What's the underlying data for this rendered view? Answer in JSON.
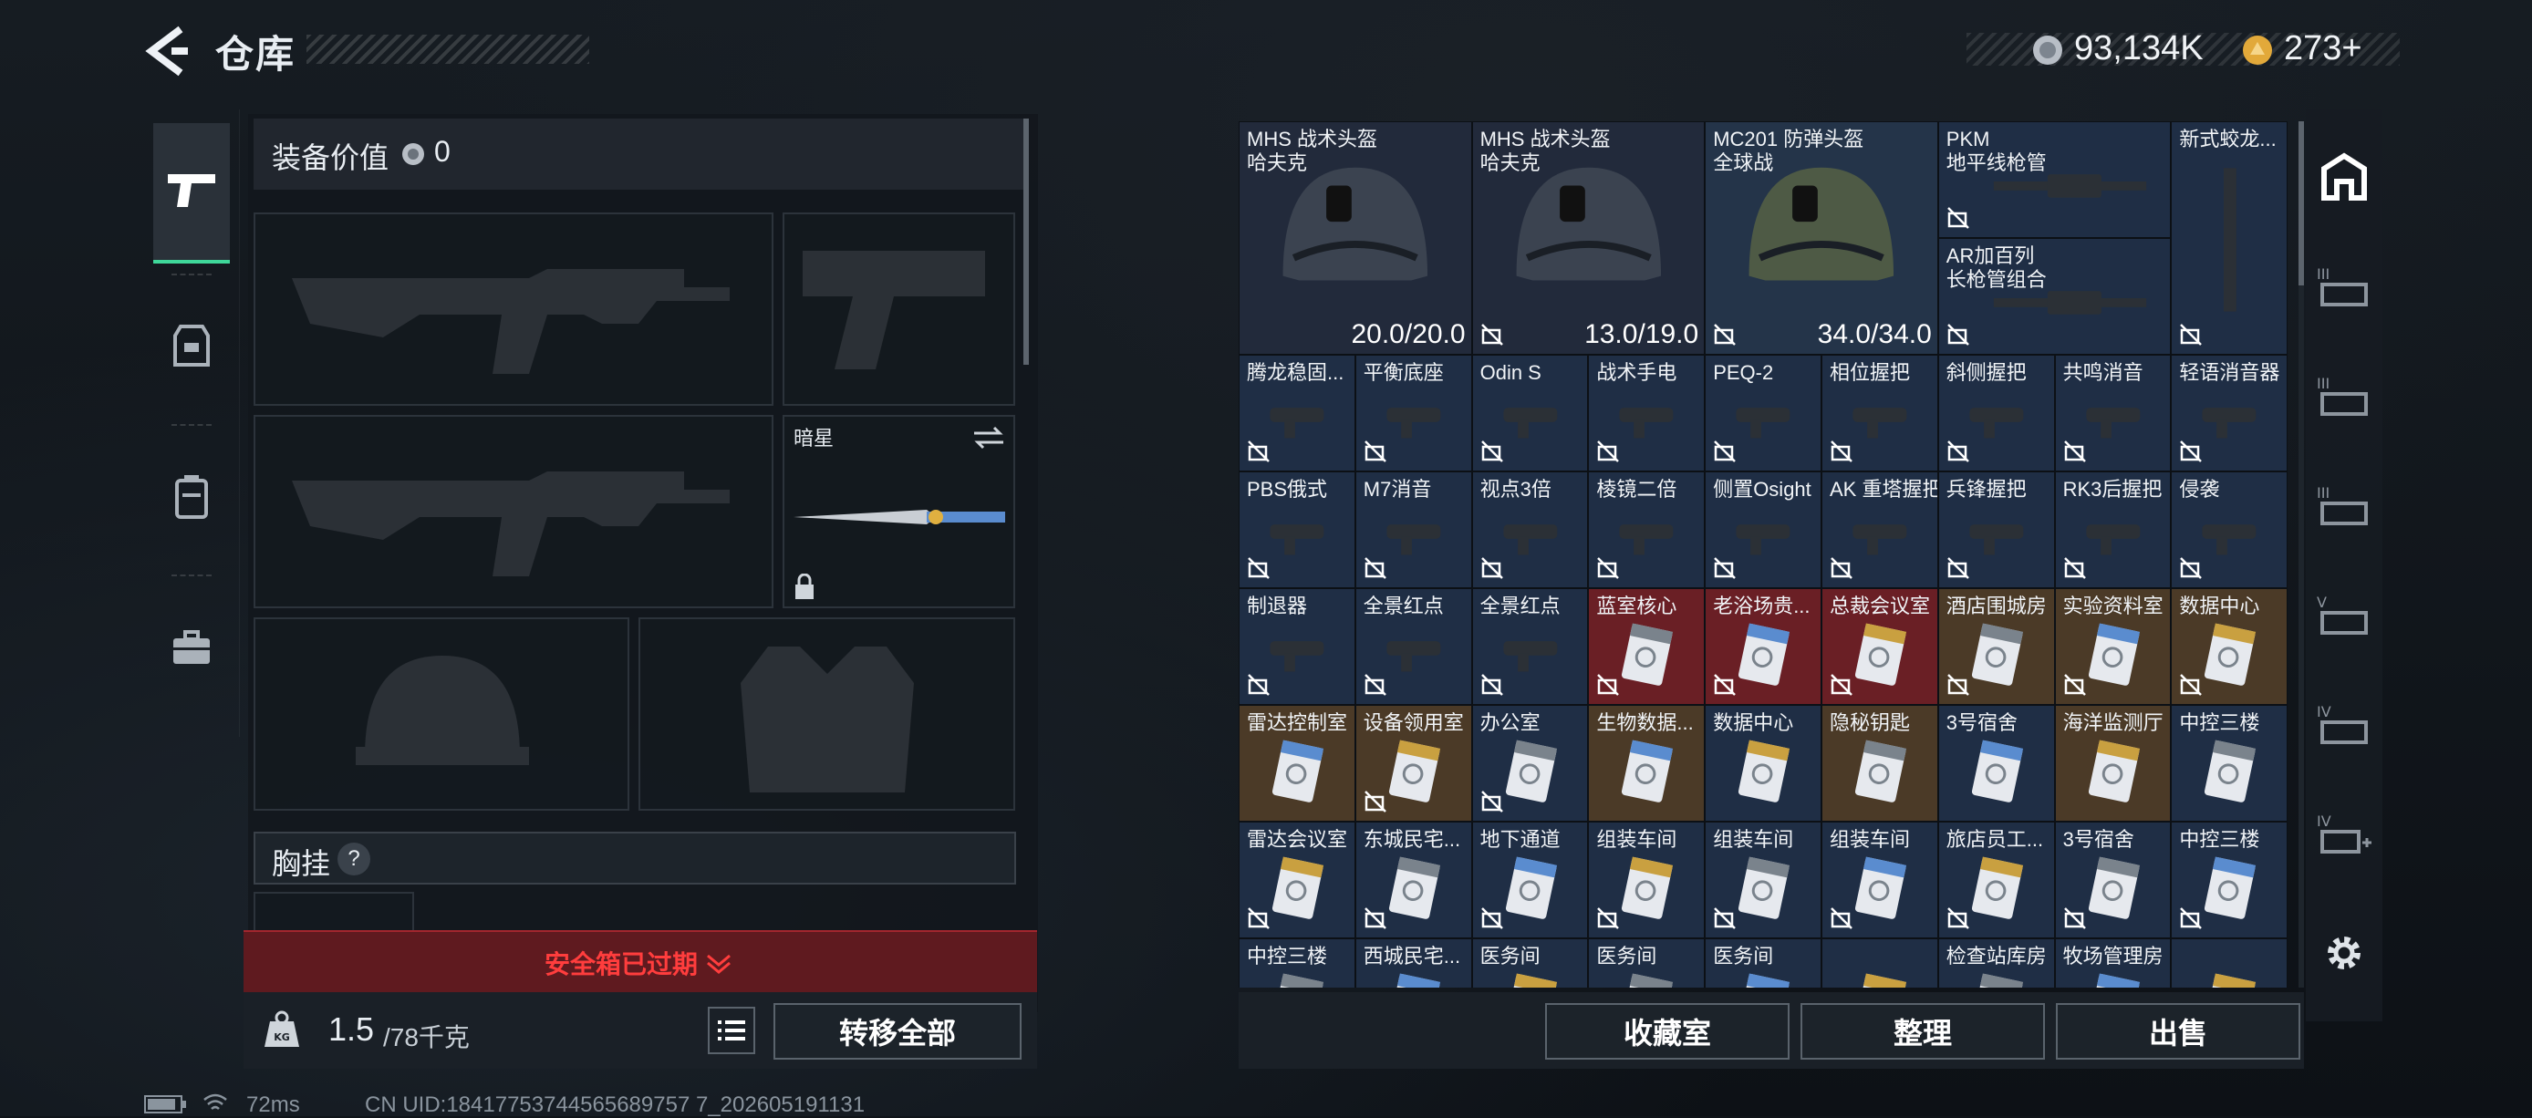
{
  "header": {
    "title": "仓库",
    "currency1": "93,134K",
    "currency2": "273+"
  },
  "equipment": {
    "value_label": "装备价值",
    "value": "0",
    "melee_name": "暗星",
    "chest_label": "胸挂",
    "chest_help": "?",
    "alert": "安全箱已过期",
    "weight_value": "1.5",
    "weight_max": "/78千克",
    "transfer_all": "转移全部"
  },
  "grid": {
    "row1": [
      {
        "name": "MHS 战术头盔",
        "sub": "哈夫克",
        "durability": "20.0/20.0"
      },
      {
        "name": "MHS 战术头盔",
        "sub": "哈夫克",
        "durability": "13.0/19.0"
      },
      {
        "name": "MC201 防弹头盔",
        "sub": "全球战",
        "durability": "34.0/34.0"
      },
      {
        "name": "PKM",
        "sub": "地平线枪管"
      },
      {
        "name": "AR加百列",
        "sub": "长枪管组合"
      },
      {
        "name": "新式蛟龙..."
      }
    ],
    "rows": [
      [
        "腾龙稳固...",
        "平衡底座",
        "Odin S",
        "战术手电",
        "PEQ-2",
        "相位握把",
        "斜侧握把",
        "共鸣消音",
        "轻语消音器"
      ],
      [
        "PBS俄式",
        "M7消音",
        "视点3倍",
        "棱镜二倍",
        "侧置Osight",
        "AK 重塔握把",
        "兵锋握把",
        "RK3后握把",
        "侵袭"
      ],
      [
        "制退器",
        "全景红点",
        "全景红点",
        "蓝室核心",
        "老浴场贵...",
        "总裁会议室",
        "酒店围城房",
        "实验资料室",
        "数据中心"
      ],
      [
        "雷达控制室",
        "设备领用室",
        "办公室",
        "生物数据...",
        "数据中心",
        "隐秘钥匙",
        "3号宿舍",
        "海洋监测厅",
        "中控三楼"
      ],
      [
        "雷达会议室",
        "东城民宅...",
        "地下通道",
        "组装车间",
        "组装车间",
        "组装车间",
        "旅店员工...",
        "3号宿舍",
        "中控三楼"
      ],
      [
        "中控三楼",
        "西城民宅...",
        "医务间",
        "医务间",
        "医务间",
        "",
        "检查站库房",
        "牧场管理房",
        ""
      ]
    ]
  },
  "actions": {
    "collection": "收藏室",
    "organize": "整理",
    "sell": "出售"
  },
  "status": {
    "ping": "72ms",
    "uid": "CN UID:18417753744565689757 7_202605191131"
  },
  "colors": {
    "accent_green": "#3fd79a",
    "alert_red": "#e13a3a",
    "cell_blue": "#1f2e45",
    "cell_red": "#6a1f25",
    "cell_gold": "#4b3a27"
  }
}
